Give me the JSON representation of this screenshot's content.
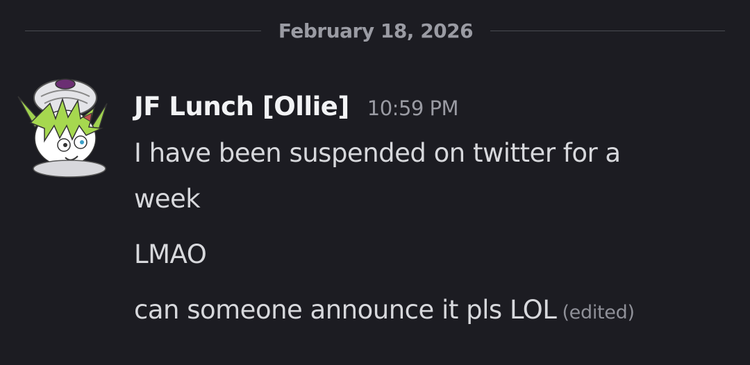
{
  "divider": {
    "date": "February 18, 2026"
  },
  "message": {
    "author": "JF Lunch [Ollie]",
    "timestamp": "10:59 PM",
    "lines": [
      "I have been suspended on twitter for a",
      "week",
      "LMAO",
      "can someone announce it pls LOL"
    ],
    "edited_label": "(edited)"
  },
  "icons": {
    "avatar": "avatar-icon"
  },
  "colors": {
    "background": "#1c1c22",
    "username": "#f2f3f5",
    "message_text": "#d7d8dc",
    "muted": "#9a9ba3",
    "divider": "#4a4b52"
  }
}
